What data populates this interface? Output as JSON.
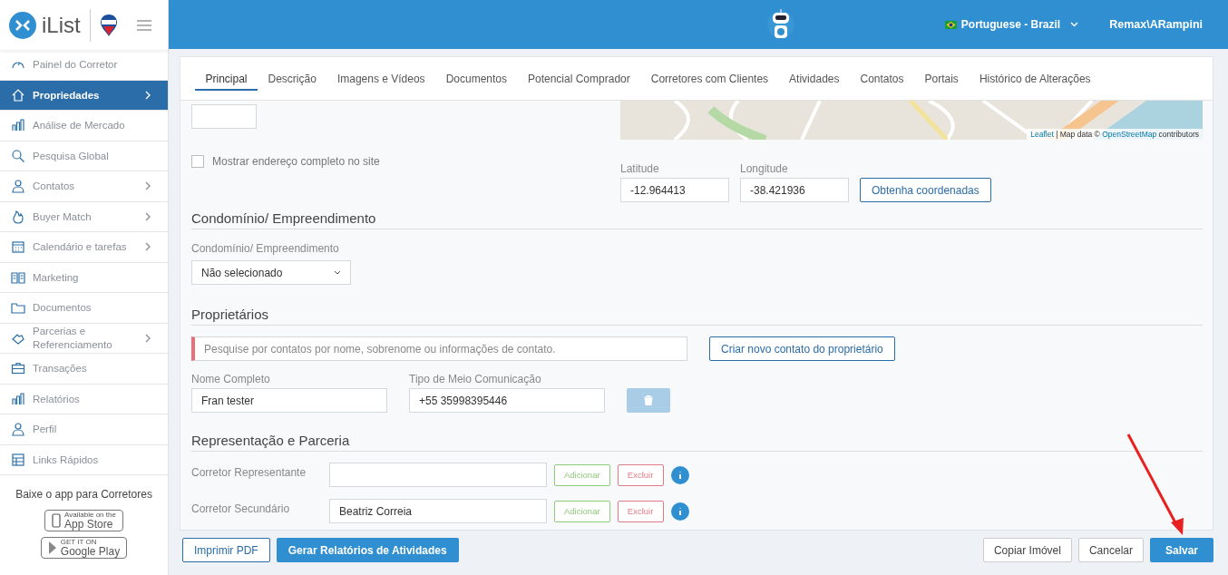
{
  "brand": {
    "name": "iList"
  },
  "sidebar": {
    "items": [
      {
        "label": "Painel do Corretor",
        "selected": false,
        "has_submenu": false
      },
      {
        "label": "Propriedades",
        "selected": true,
        "has_submenu": true
      },
      {
        "label": "Análise de Mercado",
        "selected": false,
        "has_submenu": false
      },
      {
        "label": "Pesquisa Global",
        "selected": false,
        "has_submenu": false
      },
      {
        "label": "Contatos",
        "selected": false,
        "has_submenu": true
      },
      {
        "label": "Buyer Match",
        "selected": false,
        "has_submenu": true
      },
      {
        "label": "Calendário e tarefas",
        "selected": false,
        "has_submenu": true
      },
      {
        "label": "Marketing",
        "selected": false,
        "has_submenu": false
      },
      {
        "label": "Documentos",
        "selected": false,
        "has_submenu": false
      },
      {
        "label": "Parcerias e Referenciamento",
        "selected": false,
        "has_submenu": true
      },
      {
        "label": "Transações",
        "selected": false,
        "has_submenu": false
      },
      {
        "label": "Relatórios",
        "selected": false,
        "has_submenu": false
      },
      {
        "label": "Perfil",
        "selected": false,
        "has_submenu": false
      },
      {
        "label": "Links Rápidos",
        "selected": false,
        "has_submenu": false
      }
    ],
    "app_promo": "Baixe o app para Corretores",
    "badges": [
      {
        "small": "Available on the",
        "big": "App Store"
      },
      {
        "small": "GET IT ON",
        "big": "Google Play"
      }
    ]
  },
  "topbar": {
    "language": "Portuguese - Brazil",
    "user": "Remax\\ARampini"
  },
  "tabs": [
    {
      "label": "Principal",
      "selected": true
    },
    {
      "label": "Descrição",
      "selected": false
    },
    {
      "label": "Imagens e Vídeos",
      "selected": false
    },
    {
      "label": "Documentos",
      "selected": false
    },
    {
      "label": "Potencial Comprador",
      "selected": false
    },
    {
      "label": "Corretores com Clientes",
      "selected": false
    },
    {
      "label": "Atividades",
      "selected": false
    },
    {
      "label": "Contatos",
      "selected": false
    },
    {
      "label": "Portais",
      "selected": false
    },
    {
      "label": "Histórico de Alterações",
      "selected": false
    }
  ],
  "address": {
    "show_full_address": {
      "label": "Mostrar endereço completo no site",
      "checked": false
    }
  },
  "map": {
    "attribution": {
      "link1": "Leaflet",
      "middle": "| Map data ©",
      "link2": "OpenStreetMap",
      "suffix": "contributors"
    },
    "latitude": {
      "label": "Latitude",
      "value": "-12.964413"
    },
    "longitude": {
      "label": "Longitude",
      "value": "-38.421936"
    },
    "button": "Obtenha coordenadas"
  },
  "condominium": {
    "heading": "Condomínio/ Empreendimento",
    "label": "Condomínio/ Empreendimento",
    "value": "Não selecionado"
  },
  "owners": {
    "heading": "Proprietários",
    "search_placeholder": "Pesquise por contatos por nome, sobrenome ou informações de contato.",
    "create_button": "Criar novo contato do proprietário",
    "name_label": "Nome Completo",
    "name_value": "Fran tester",
    "contact_label": "Tipo de Meio Comunicação",
    "contact_value": "+55 35998395446"
  },
  "representation": {
    "heading": "Representação e Parceria",
    "rows": [
      {
        "label": "Corretor Representante",
        "value": "",
        "add": "Adicionar",
        "remove": "Excluir"
      },
      {
        "label": "Corretor Secundário",
        "value": "Beatriz Correia",
        "add": "Adicionar",
        "remove": "Excluir"
      }
    ]
  },
  "footer": {
    "left_buttons": [
      "Imprimir PDF",
      "Gerar Relatórios de Atividades"
    ],
    "right_buttons": [
      "Copiar Imóvel",
      "Cancelar",
      "Salvar"
    ]
  }
}
